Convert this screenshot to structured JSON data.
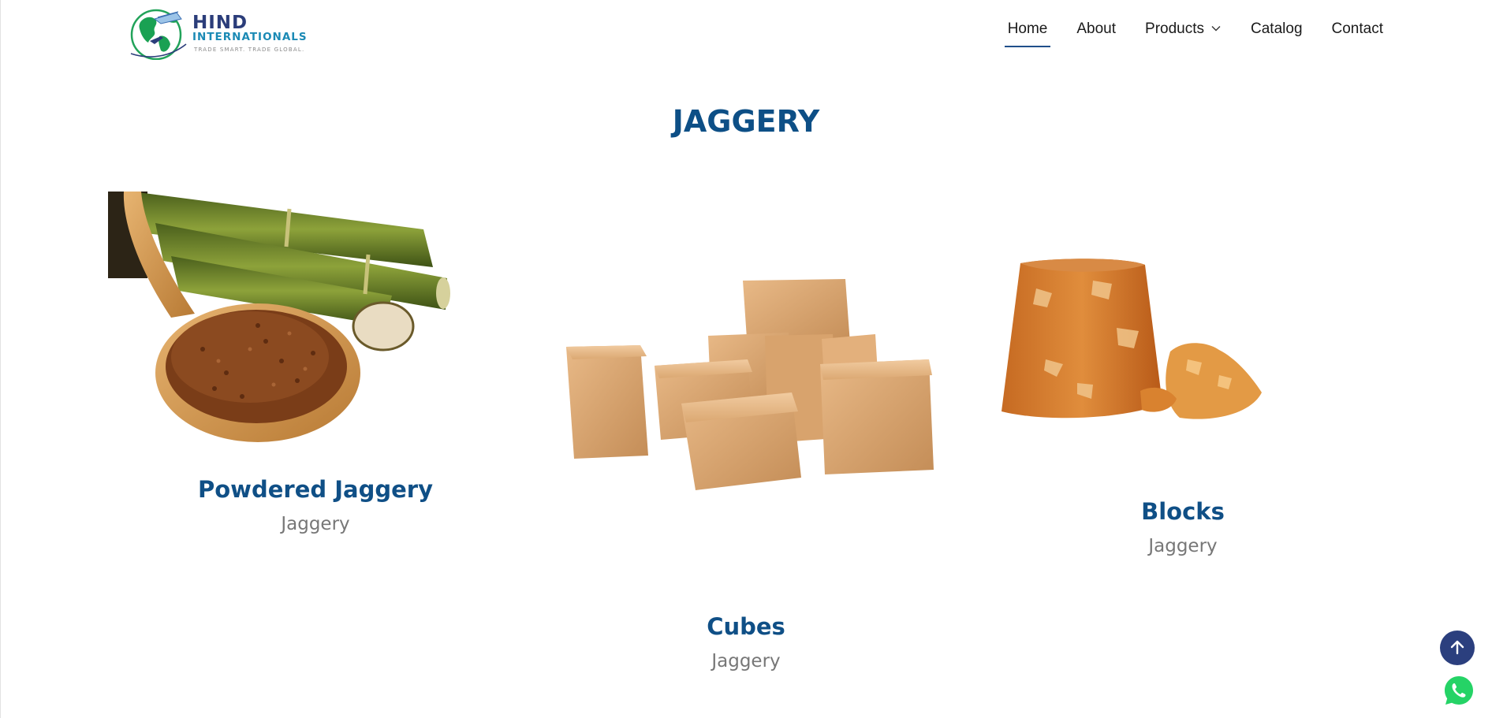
{
  "brand": {
    "name": "HIND",
    "subtitle": "INTERNATIONALS",
    "tagline": "TRADE SMART. TRADE GLOBAL."
  },
  "nav": {
    "items": [
      {
        "label": "Home",
        "active": true
      },
      {
        "label": "About",
        "active": false
      },
      {
        "label": "Products",
        "active": false,
        "has_dropdown": true
      },
      {
        "label": "Catalog",
        "active": false
      },
      {
        "label": "Contact",
        "active": false
      }
    ]
  },
  "section": {
    "title": "JAGGERY"
  },
  "products": [
    {
      "name": "Powdered Jaggery",
      "category": "Jaggery",
      "image": "powdered-jaggery-spoon-sugarcane"
    },
    {
      "name": "Cubes",
      "category": "Jaggery",
      "image": "jaggery-cubes"
    },
    {
      "name": "Blocks",
      "category": "Jaggery",
      "image": "jaggery-block"
    }
  ],
  "floating": {
    "scroll_top_icon": "arrow-up-icon",
    "whatsapp_icon": "whatsapp-icon"
  },
  "colors": {
    "primary": "#0d4f86",
    "nav_text": "#1a1a1a",
    "muted": "#777777",
    "fab_blue": "#2b3f7e",
    "whatsapp": "#25d366"
  }
}
